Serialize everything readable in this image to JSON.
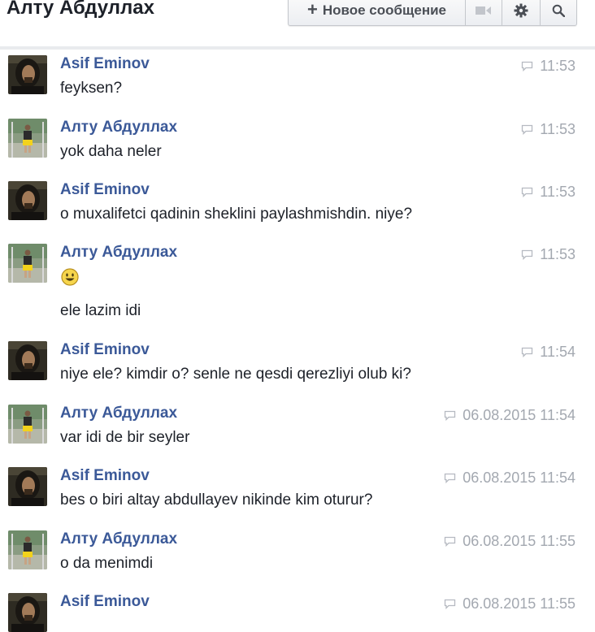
{
  "header": {
    "title": "Алту Абдуллах",
    "new_message_label": "Новое сообщение",
    "icons": [
      "plus-icon",
      "video-icon",
      "gear-icon",
      "search-icon"
    ]
  },
  "colors": {
    "sender_name": "#3b5998",
    "timestamp": "#a3a8b0",
    "divider": "#e9ebee"
  },
  "messages": [
    {
      "sender": "Asif Eminov",
      "avatar": "asif-avatar",
      "time": "11:53",
      "text": "feyksen?"
    },
    {
      "sender": "Алту Абдуллах",
      "avatar": "altu-avatar",
      "time": "11:53",
      "text": "yok daha neler"
    },
    {
      "sender": "Asif Eminov",
      "avatar": "asif-avatar",
      "time": "11:53",
      "text": "o muxalifetci qadinin sheklini paylashmishdin. niye?"
    },
    {
      "sender": "Алту Абдуллах",
      "avatar": "altu-avatar",
      "time": "11:53",
      "emoji": "smiley-emoji",
      "text": "ele lazim idi"
    },
    {
      "sender": "Asif Eminov",
      "avatar": "asif-avatar",
      "time": "11:54",
      "text": "niye ele? kimdir o? senle ne qesdi qerezliyi olub ki?"
    },
    {
      "sender": "Алту Абдуллах",
      "avatar": "altu-avatar",
      "time": "06.08.2015 11:54",
      "text": "var idi de bir seyler"
    },
    {
      "sender": "Asif Eminov",
      "avatar": "asif-avatar",
      "time": "06.08.2015 11:54",
      "text": "bes o biri altay abdullayev nikinde kim oturur?"
    },
    {
      "sender": "Алту Абдуллах",
      "avatar": "altu-avatar",
      "time": "06.08.2015 11:55",
      "text": "o da menimdi"
    },
    {
      "sender": "Asif Eminov",
      "avatar": "asif-avatar",
      "time": "06.08.2015 11:55",
      "text": ""
    }
  ]
}
